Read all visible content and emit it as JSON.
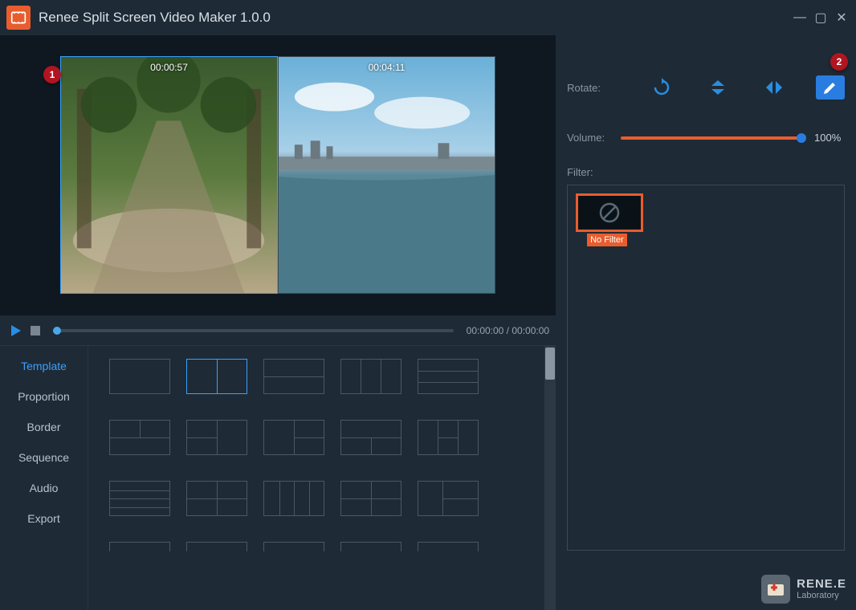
{
  "app": {
    "title": "Renee Split Screen Video Maker 1.0.0"
  },
  "badges": {
    "b1": "1",
    "b2": "2"
  },
  "clips": [
    {
      "time": "00:00:57",
      "selected": true
    },
    {
      "time": "00:04:11",
      "selected": false
    }
  ],
  "transport": {
    "timecode": "00:00:00 / 00:00:00"
  },
  "tabs": [
    {
      "label": "Template",
      "active": true
    },
    {
      "label": "Proportion",
      "active": false
    },
    {
      "label": "Border",
      "active": false
    },
    {
      "label": "Sequence",
      "active": false
    },
    {
      "label": "Audio",
      "active": false
    },
    {
      "label": "Export",
      "active": false
    }
  ],
  "right": {
    "rotate_label": "Rotate:",
    "volume_label": "Volume:",
    "volume_value": "100%",
    "filter_label": "Filter:",
    "filter_none": "No Filter"
  },
  "brand": {
    "line1": "RENE.E",
    "line2": "Laboratory"
  }
}
